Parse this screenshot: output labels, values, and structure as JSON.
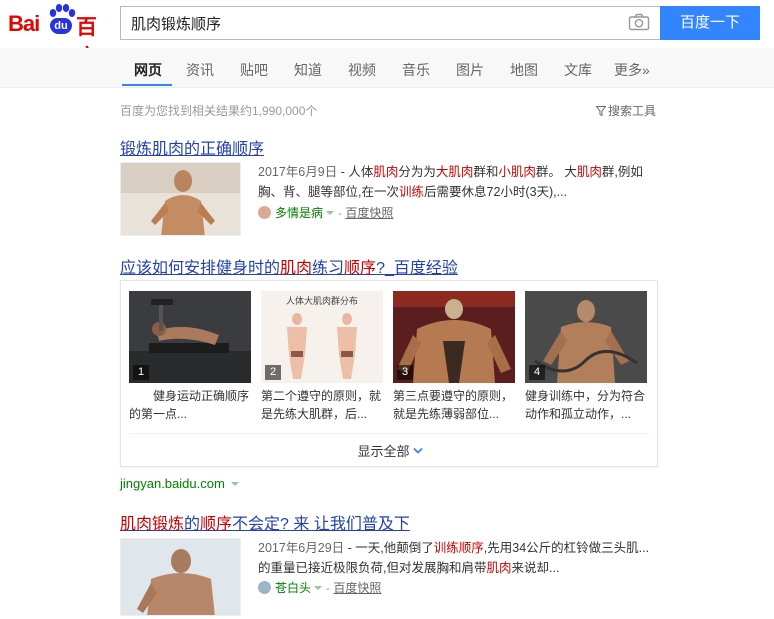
{
  "search": {
    "query": "肌肉锻炼顺序",
    "button_label": "百度一下"
  },
  "logo": {
    "latin_left": "Bai",
    "latin_box": "du",
    "chinese": "百度"
  },
  "tabs": [
    {
      "label": "网页"
    },
    {
      "label": "资讯"
    },
    {
      "label": "贴吧"
    },
    {
      "label": "知道"
    },
    {
      "label": "视频"
    },
    {
      "label": "音乐"
    },
    {
      "label": "图片"
    },
    {
      "label": "地图"
    },
    {
      "label": "文库"
    },
    {
      "label": "更多»"
    }
  ],
  "result_count": "百度为您找到相关结果约1,990,000个",
  "search_tools": "搜索工具",
  "results": [
    {
      "title": "锻炼肌肉的正确顺序",
      "date": "2017年6月9日",
      "snippet_parts": [
        "人体",
        "肌肉",
        "分为为",
        "大肌肉",
        "群和",
        "小肌肉",
        "群。 大",
        "肌肉",
        "群,例如胸、背、腿等部位,在一次",
        "训练",
        "后需要休息72小时(3天),..."
      ],
      "source": "多情是病",
      "snapshot": "百度快照"
    },
    {
      "title_parts": [
        "应该如何安排健身时的",
        "肌肉",
        "练习",
        "顺序",
        "?_百度经验"
      ],
      "steps": [
        {
          "num": "1",
          "text": "健身运动正确顺序的第一点..."
        },
        {
          "num": "2",
          "text": "第二个遵守的原则，就是先练大肌群，后..."
        },
        {
          "num": "3",
          "text": "第三点要遵守的原则，就是先练薄弱部位..."
        },
        {
          "num": "4",
          "text": "健身训练中，分为符合动作和孤立动作，..."
        }
      ],
      "step2_image_caption": "人体大肌肉群分布",
      "show_all": "显示全部",
      "url": "jingyan.baidu.com"
    },
    {
      "title_parts": [
        "肌肉锻炼",
        "的",
        "顺序",
        "不会定? 来 让我们普及下"
      ],
      "date": "2017年6月29日",
      "snippet_parts": [
        "一天,他颠倒了",
        "训练顺序",
        ",先用34公斤的杠铃做三头肌...的重量已接近极限负荷,但对发展胸和肩带",
        "肌肉",
        "来说却..."
      ],
      "source": "苍白头",
      "snapshot": "百度快照"
    }
  ],
  "colors": {
    "brand_red": "#e10602",
    "brand_blue": "#2932e1",
    "search_button": "#3385ff",
    "link_blue": "#2440b3",
    "highlight_red": "#cc0000",
    "source_green": "#008000"
  }
}
